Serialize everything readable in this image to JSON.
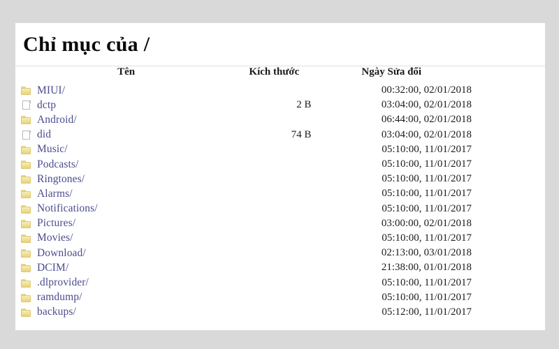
{
  "page": {
    "title": "Chỉ mục của /"
  },
  "table": {
    "headers": {
      "name": "Tên",
      "size": "Kích thước",
      "modified": "Ngày Sửa đổi"
    },
    "rows": [
      {
        "icon": "folder-icon",
        "name": "MIUI/",
        "size": "",
        "modified": "00:32:00, 02/01/2018"
      },
      {
        "icon": "file-icon",
        "name": "dctp",
        "size": "2 B",
        "modified": "03:04:00, 02/01/2018"
      },
      {
        "icon": "folder-icon",
        "name": "Android/",
        "size": "",
        "modified": "06:44:00, 02/01/2018"
      },
      {
        "icon": "file-icon",
        "name": "did",
        "size": "74 B",
        "modified": "03:04:00, 02/01/2018"
      },
      {
        "icon": "folder-icon",
        "name": "Music/",
        "size": "",
        "modified": "05:10:00, 11/01/2017"
      },
      {
        "icon": "folder-icon",
        "name": "Podcasts/",
        "size": "",
        "modified": "05:10:00, 11/01/2017"
      },
      {
        "icon": "folder-icon",
        "name": "Ringtones/",
        "size": "",
        "modified": "05:10:00, 11/01/2017"
      },
      {
        "icon": "folder-icon",
        "name": "Alarms/",
        "size": "",
        "modified": "05:10:00, 11/01/2017"
      },
      {
        "icon": "folder-icon",
        "name": "Notifications/",
        "size": "",
        "modified": "05:10:00, 11/01/2017"
      },
      {
        "icon": "folder-icon",
        "name": "Pictures/",
        "size": "",
        "modified": "03:00:00, 02/01/2018"
      },
      {
        "icon": "folder-icon",
        "name": "Movies/",
        "size": "",
        "modified": "05:10:00, 11/01/2017"
      },
      {
        "icon": "folder-icon",
        "name": "Download/",
        "size": "",
        "modified": "02:13:00, 03/01/2018"
      },
      {
        "icon": "folder-icon",
        "name": "DCIM/",
        "size": "",
        "modified": "21:38:00, 01/01/2018"
      },
      {
        "icon": "folder-icon",
        "name": ".dlprovider/",
        "size": "",
        "modified": "05:10:00, 11/01/2017"
      },
      {
        "icon": "folder-icon",
        "name": "ramdump/",
        "size": "",
        "modified": "05:10:00, 11/01/2017"
      },
      {
        "icon": "folder-icon",
        "name": "backups/",
        "size": "",
        "modified": "05:12:00, 11/01/2017"
      }
    ]
  },
  "colors": {
    "link": "#4b4b8f",
    "page_background": "#d9d9d9",
    "sheet_background": "#ffffff",
    "folder_icon": "#efdf94",
    "rule": "#dededa"
  }
}
